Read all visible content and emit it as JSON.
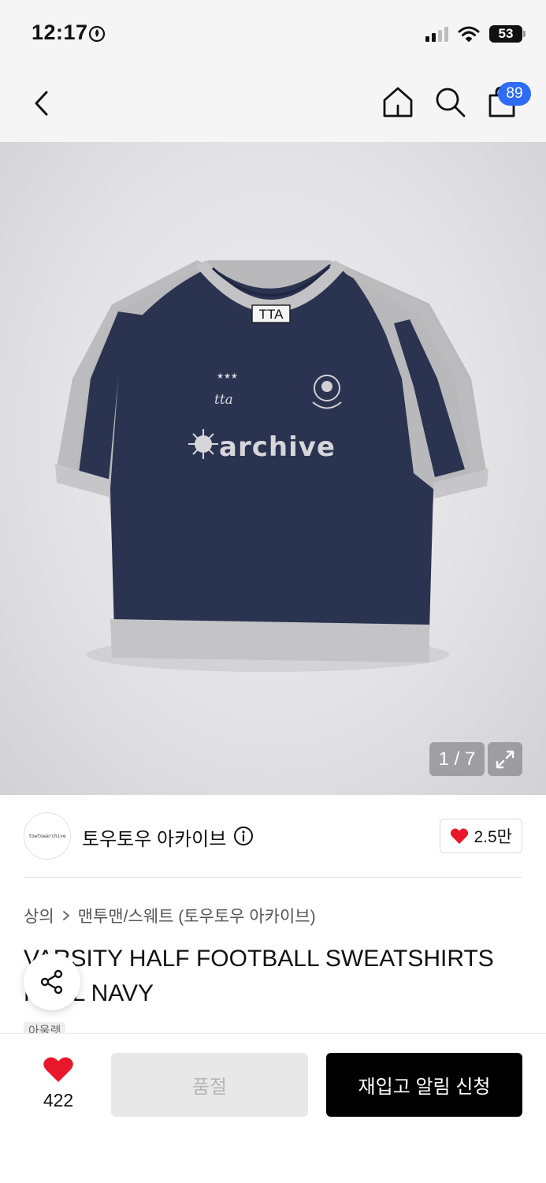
{
  "status_bar": {
    "time": "12:17",
    "battery": "53"
  },
  "nav": {
    "cart_count": "89"
  },
  "gallery": {
    "page_indicator": "1 / 7",
    "shirt_label": "TTA",
    "print_text": "archive",
    "emblem_text": "tta"
  },
  "brand": {
    "logo_text": "towtowarchive",
    "name": "토우토우 아카이브",
    "likes": "2.5만"
  },
  "breadcrumb": {
    "items": [
      "상의",
      "맨투맨/스웨트 (토우토우 아카이브)"
    ]
  },
  "product": {
    "title": "VARSITY HALF FOOTBALL SWEATSHIRTS REAL NAVY",
    "tag": "아울렛"
  },
  "bottom_bar": {
    "wish_count": "422",
    "soldout_label": "품절",
    "restock_label": "재입고 알림 신청"
  },
  "colors": {
    "accent": "#2f6cf6",
    "heart": "#e8182a",
    "navy": "#2a3350",
    "heather_gray": "#b9b9bc"
  }
}
